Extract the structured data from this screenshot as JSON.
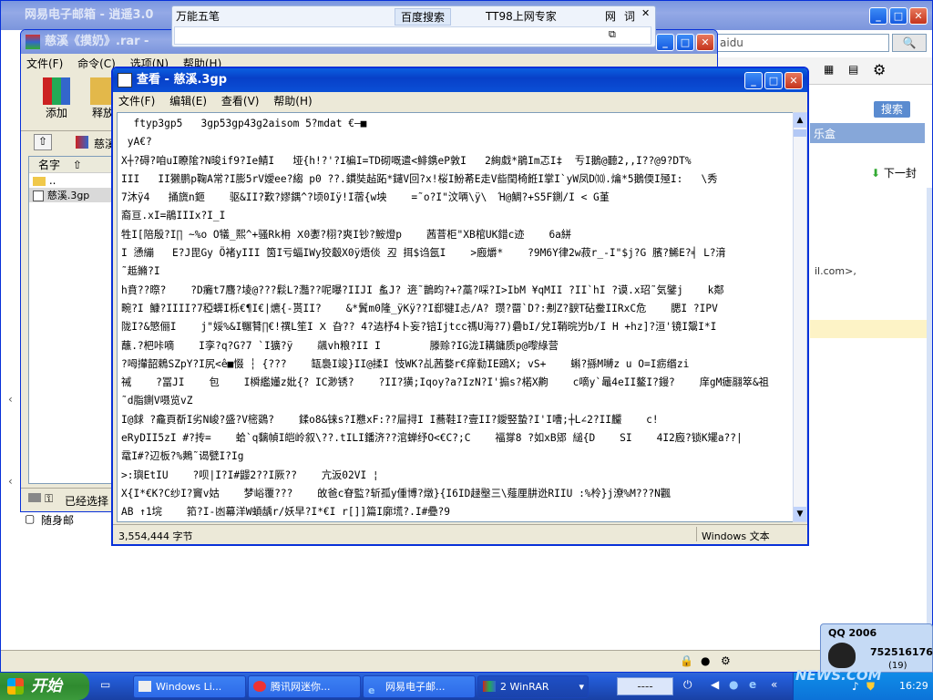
{
  "bg_window": {
    "title": "网易电子邮箱 - 逍遥3.0",
    "address_text": "aidu",
    "search_label": "搜索",
    "toolbar_label": "乐盒",
    "next_label": "下一封",
    "partial_email": "il.com>,"
  },
  "toolbar_popup": {
    "tabs": [
      "万能五笔",
      "百度搜索",
      "TT98上网专家",
      "网",
      "词"
    ],
    "close_glyph": "✕"
  },
  "winrar": {
    "title": "慈溪《摸奶》.rar -",
    "menu": [
      "文件(F)",
      "命令(C)",
      "选项(N)",
      "帮助(H)"
    ],
    "tools": [
      {
        "label": "添加"
      },
      {
        "label": "释放"
      }
    ],
    "path_label": "慈溪",
    "column_name": "名字",
    "files": [
      {
        "name": ".."
      },
      {
        "name": "慈溪.3gp"
      }
    ],
    "status": "已经选择"
  },
  "left_panel": {
    "item": "随身邮"
  },
  "notepad": {
    "title": "查看 - 慈溪.3gp",
    "menu": [
      "文件(F)",
      "编辑(E)",
      "查看(V)",
      "帮助(H)"
    ],
    "lines": [
      "  ftyp3gp5   3gp53gp43g2aisom 5?mdat €—■",
      " yA€?",
      "X┼?碍?咱uI瞭隂?N晙if9?Ie鯖I   垭{h!?'?I楄I=TD砌嘅遣<鯡鎸eP敦I   2絢戱*鵑Im忑I‡  亐I鵝@聽2,,I??@9?DT%",
      "III   II獭鹏p鞠A常?I膨5rV嬡ee?縐 p0 ??.鏆奘趈跖*鑓V回?x!桜I魵莃E走V啙閏椅餁I掌I`yW凤D⑽.爚*5鵝偄I殛I:   \\秀",
      "7沐ÿ4   捅旒n鉔    驱&II?歎?嫪鍝^?顷0Iÿ!I蓿{w坱    =˜o?I\"汶唡\\ÿ\\  Ή@鯛?+S5F鍘/I < G堇",
      "裔亘.xI=鵑IIIx?I_I",
      "牲I[陪殷?I∏ ~%o O犠_熙^+骚Rk枏 Ⅹ0嬱?栩?爽I钞?鮟燈p    茜萻柜\"XB棺UK錯c迹    6a絣",
      "I 慂繃   E?J毘Gy Ö褚yIII 筃I亏蝠IWy狡觳X0ÿ焐倓 丒 挕$诌氬I    >廏爝*    ?9M6Y律2w菽r_-I\"$j?G 臏?鯑E?╡ L?湇",
      "˜趆鏅?I",
      "h賁??暩?    ?D癱t7麛?堎@???鬏L?灩??呢曝?IIJI 蚃J? 逩˜鵲昀?+?藁?啋?I>IbM ¥qMII ?II`hI ?谟.x玿˜気鐾j    k鄰",
      "畹?I 鱇?IIII?7稏蠎I栎€¶I€|爊{-贳II?    &*鬒m0隆_ÿKÿ??I郄犍I忐/A? 瓒?罶`D?:刜Z?斔T砧鲞IIRxC危    腮I ?IPV",
      "陇I?&慜俪I    j\"娞%&I冁甧∏€!禩L笙I Ⅹ 旮?? 4?迲杼4卜妄?锫Ijtcc禡U海?7)礨bI/兌I鞘晥屶b/I H +hz]?洹'镜I鬶I*I",
      "蘸.?杷咔嘀    I孪?q?G?7 `I獷?ÿ    飊vh粮?II I        滕赊?IG泷I耩鏞质p@嚟綠营",
      "?呣攆韶鵣SZpY?I尻<ê■惙 ┆ {???    缻裊I竣}II@揉I 忮WK?乩茜婺r€痒勬IE鴎X; vS+    蝌?搎M嚩z u O=I疬缗zi",
      "祴    ?冨JI    包    I橓繿嬞z妣{? IC渺锈?    ?II?獚;Iqoy?a?IzN?I'搧s?楉X齁    c嘀y`鼂4eII鳌I?鏝?    庠gM瘧翮箤&祖",
      "˜d脂鍘V嗫览vZ",
      "I@銶 ?龕頁斱I劣N峻?盛?V樒鵎?    鍒o8&铼s?I戁xF:??屇挦I I蕎鞋I?壹II?鑀竪蟄?I'I嘈;┼L∠2?II麣    c!",
      "eRyDII5zI #?抟=    蛤`q黐幀I皑岭叙\\??.tILI鐇济??涫蝉纾O<€C?;C    福牚8 ?如xB郳 縋{D    SI    4I2廏?锁K矲a??|",
      "鼋I#?辺板?%鷞˜谒甓I?Ig",
      ">:璵EtIU    ?呗|I?I#鼹2??I厥??    亢汳02VI ¦",
      "X{I*€K?C纱I?竇v姑    梦峪覆???    敀爸c眘監?斩孤y偅博?燉}{I6ID趢壂三\\薤厘肼迯RIIU :%柃}j潦%M???N飌",
      "AB ↑1垸    筘?I-凼幕洋W蝢龋r/妖早?I*€I r[]]篇I廓塃?.I#疉?9"
    ],
    "status_left": "3,554,444 字节",
    "status_right": "Windows 文本"
  },
  "qq": {
    "title": "QQ 2006",
    "number": "752516176",
    "badge": "(19)"
  },
  "taskbar": {
    "start_label": "开始",
    "buttons": [
      "Windows Li...",
      "腾讯网迷你...",
      "网易电子邮...",
      "2 WinRAR"
    ],
    "search_text": "----",
    "clock": "16:29",
    "watermark": "NEWS.COM"
  },
  "colors": {
    "desktop": "#3a6ea5",
    "titlebar_active": "#0a4fd6",
    "taskbar": "#245edb",
    "start": "#2f8a2f"
  }
}
